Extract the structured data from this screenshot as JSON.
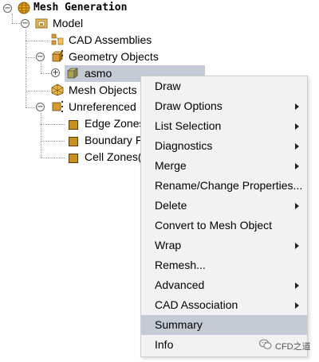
{
  "tree": {
    "root": {
      "label": "Mesh Generation",
      "toggle": "−"
    },
    "model": {
      "label": "Model",
      "toggle": "−"
    },
    "cad_assemblies": {
      "label": "CAD Assemblies"
    },
    "geometry_objects": {
      "label": "Geometry Objects",
      "toggle": "−"
    },
    "asmo": {
      "label": "asmo",
      "toggle": "+"
    },
    "mesh_objects": {
      "label": "Mesh Objects"
    },
    "unreferenced": {
      "label": "Unreferenced",
      "toggle": "−"
    },
    "edge_zones": {
      "label": "Edge Zones"
    },
    "boundary": {
      "label": "Boundary F"
    },
    "cell_zones": {
      "label": "Cell Zones("
    }
  },
  "context_menu": {
    "items": [
      {
        "label": "Draw",
        "submenu": false
      },
      {
        "label": "Draw Options",
        "submenu": true
      },
      {
        "label": "List Selection",
        "submenu": true
      },
      {
        "label": "Diagnostics",
        "submenu": true
      },
      {
        "label": "Merge",
        "submenu": true
      },
      {
        "label": "Rename/Change Properties...",
        "submenu": false
      },
      {
        "label": "Delete",
        "submenu": true
      },
      {
        "label": "Convert to Mesh Object",
        "submenu": false
      },
      {
        "label": "Wrap",
        "submenu": true
      },
      {
        "label": "Remesh...",
        "submenu": false
      },
      {
        "label": "Advanced",
        "submenu": true
      },
      {
        "label": "CAD Association",
        "submenu": true
      },
      {
        "label": "Summary",
        "submenu": false,
        "highlighted": true
      },
      {
        "label": "Info",
        "submenu": false
      }
    ]
  },
  "watermark": {
    "text": "CFD之道"
  },
  "colors": {
    "selection": "#c5cbd6",
    "menu_bg": "#f2f2f2",
    "zone_icon": "#c8901e",
    "globe": "#e2a21c"
  }
}
